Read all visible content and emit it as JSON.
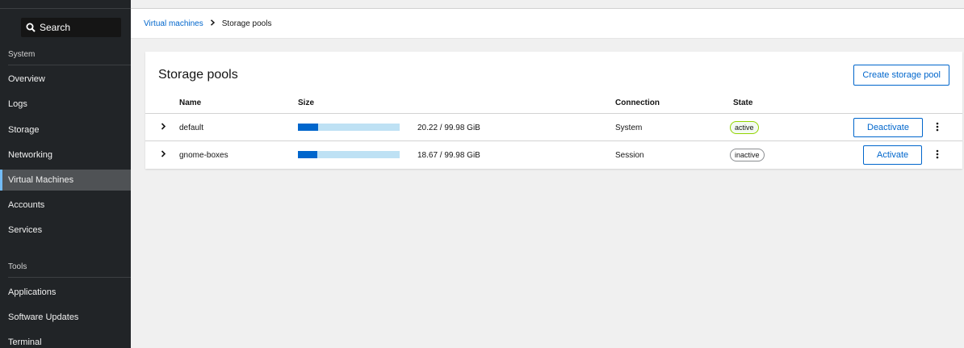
{
  "sidebar": {
    "search_label": "Search",
    "system_label": "System",
    "tools_label": "Tools",
    "system_items": [
      {
        "label": "Overview"
      },
      {
        "label": "Logs"
      },
      {
        "label": "Storage"
      },
      {
        "label": "Networking"
      },
      {
        "label": "Virtual Machines"
      },
      {
        "label": "Accounts"
      },
      {
        "label": "Services"
      }
    ],
    "tools_items": [
      {
        "label": "Applications"
      },
      {
        "label": "Software Updates"
      },
      {
        "label": "Terminal"
      }
    ],
    "active_item": "Virtual Machines",
    "accent_color": "#73bcf7"
  },
  "breadcrumb": {
    "parent": "Virtual machines",
    "current": "Storage pools"
  },
  "card": {
    "title": "Storage pools",
    "create_label": "Create storage pool"
  },
  "table": {
    "headers": {
      "name": "Name",
      "size": "Size",
      "connection": "Connection",
      "state": "State"
    },
    "rows": [
      {
        "name": "default",
        "size_text": "20.22 / 99.98 GiB",
        "usage_fraction": 0.2022,
        "connection": "System",
        "state": "active",
        "action": "Deactivate"
      },
      {
        "name": "gnome-boxes",
        "size_text": "18.67 / 99.98 GiB",
        "usage_fraction": 0.1867,
        "connection": "Session",
        "state": "inactive",
        "action": "Activate"
      }
    ]
  },
  "colors": {
    "primary": "#0066cc",
    "bar_track": "#bee1f4",
    "active_badge_border": "#92d400"
  }
}
